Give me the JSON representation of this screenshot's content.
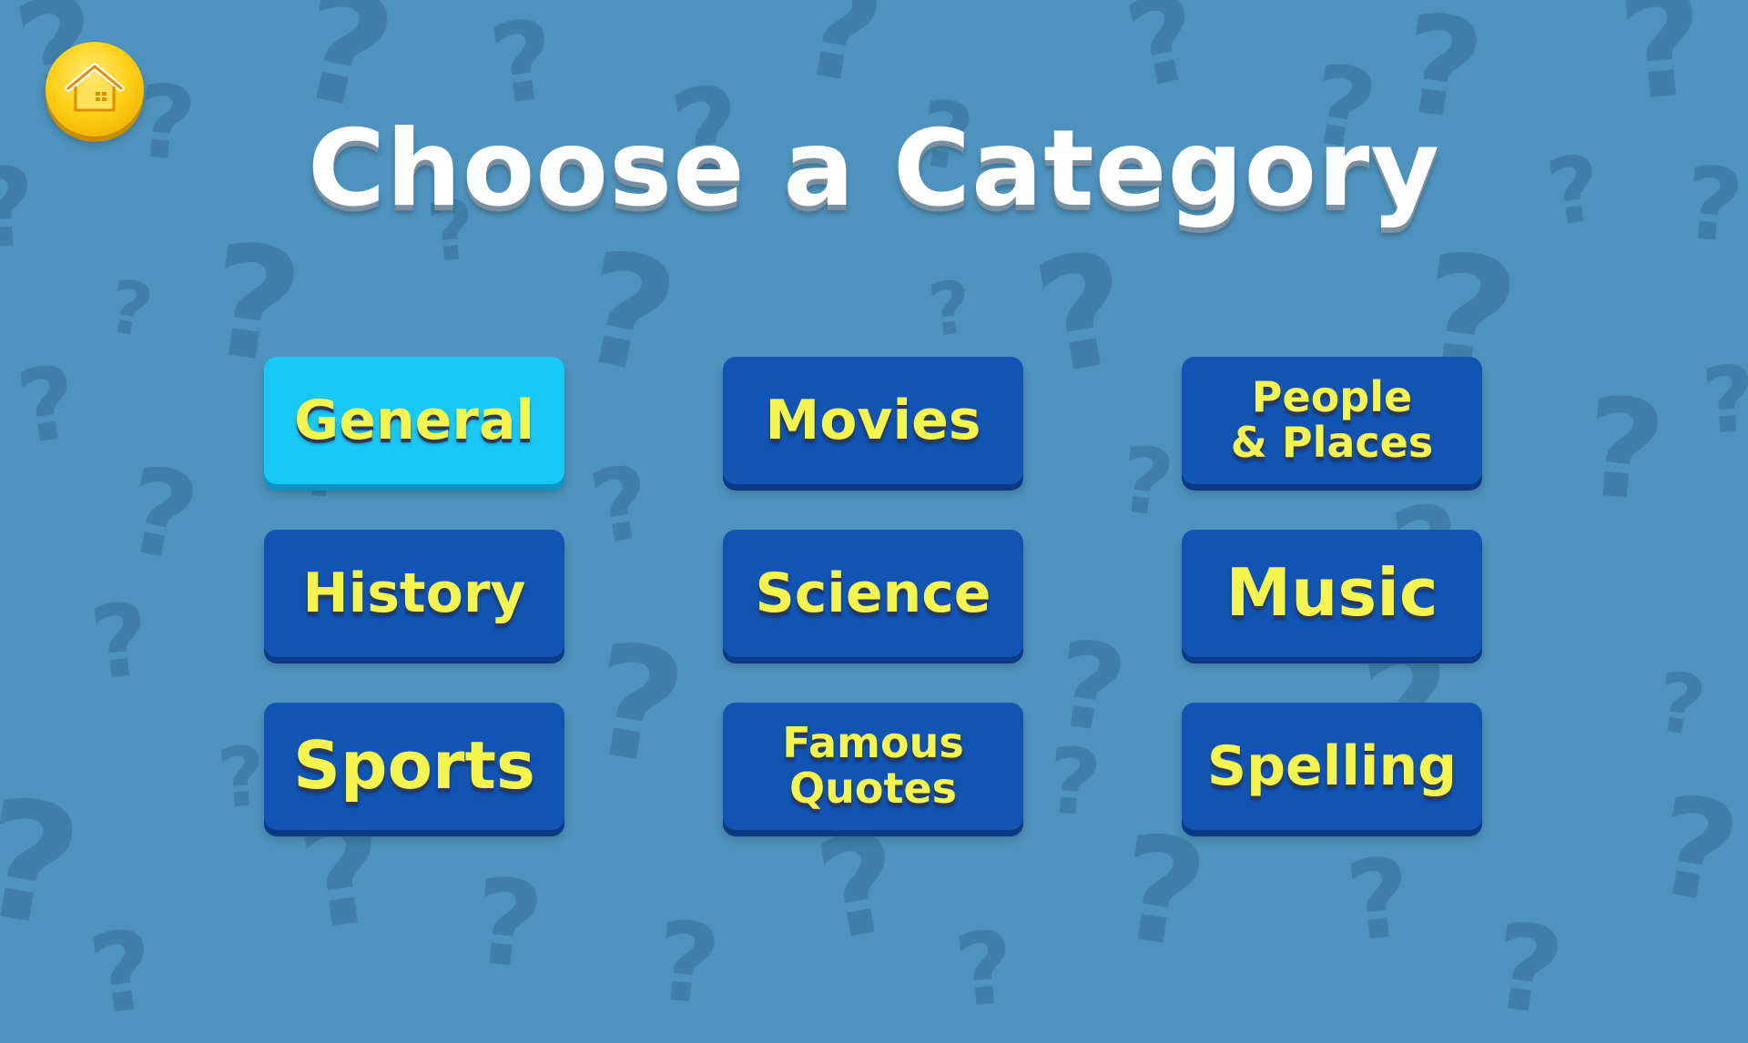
{
  "title": "Choose a Category",
  "home_button": {
    "icon": "home-icon"
  },
  "background": {
    "icon": "question-mark-pattern",
    "color": "#4e93bd"
  },
  "categories": [
    {
      "label": "General",
      "selected": true
    },
    {
      "label": "Movies",
      "selected": false
    },
    {
      "label": "People\n& Places",
      "selected": false
    },
    {
      "label": "History",
      "selected": false
    },
    {
      "label": "Science",
      "selected": false
    },
    {
      "label": "Music",
      "selected": false
    },
    {
      "label": "Sports",
      "selected": false
    },
    {
      "label": "Famous\nQuotes",
      "selected": false
    },
    {
      "label": "Spelling",
      "selected": false
    }
  ],
  "colors": {
    "button": "#1154b3",
    "button_selected": "#18c8f7",
    "button_text": "#f6f54d",
    "title_text": "#ffffff",
    "home_button": "#ffd21a"
  }
}
